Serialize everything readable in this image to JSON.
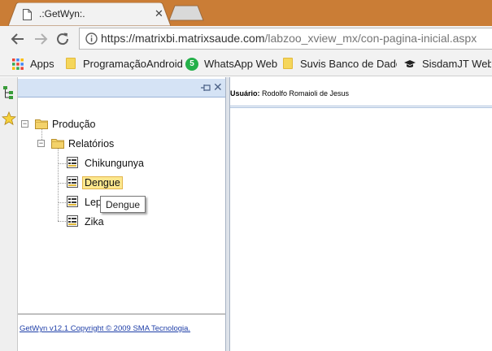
{
  "browser": {
    "tab": {
      "title": ".:GetWyn:.",
      "close": "✕"
    },
    "url": {
      "host": "https://matrixbi.matrixsaude.com",
      "path": "/labzoo_xview_mx/con-pagina-inicial.aspx"
    },
    "bookmarks": [
      {
        "label": "Apps"
      },
      {
        "label": "ProgramaçãoAndroid"
      },
      {
        "label": "WhatsApp Web",
        "badge": "5"
      },
      {
        "label": "Suvis Banco de Dado"
      },
      {
        "label": "SisdamJT Web"
      }
    ]
  },
  "panel": {
    "close": "✕",
    "tree": {
      "root": "Produção",
      "folder": "Relatórios",
      "items": [
        "Chikungunya",
        "Dengue",
        "Lep",
        "Zika"
      ]
    },
    "tooltip": "Dengue",
    "footer": "GetWyn v12.1 Copyright © 2009 SMA Tecnologia."
  },
  "content": {
    "user_label": "Usuário:",
    "user_name": "Rodolfo Romaioli de Jesus"
  },
  "colors": {
    "tabstrip": "#ca7d36",
    "panel_header": "#d5e3f5",
    "selected_node": "#fce78e",
    "link": "#1f3fa8"
  }
}
